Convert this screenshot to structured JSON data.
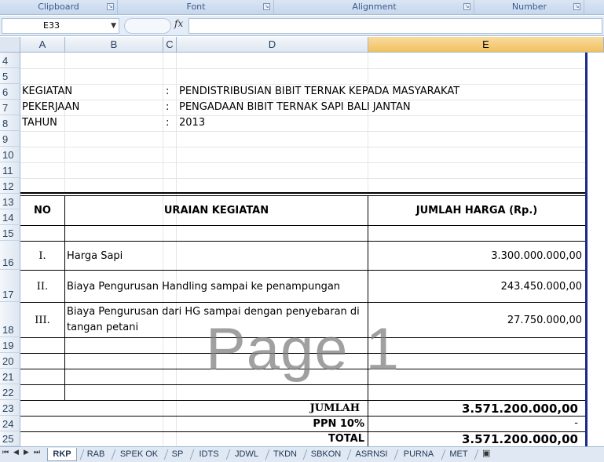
{
  "ribbon": {
    "groups": [
      "Clipboard",
      "Font",
      "Alignment",
      "Number"
    ]
  },
  "formula_bar": {
    "name_box": "E33",
    "fx_label": "fx",
    "formula": ""
  },
  "columns": [
    "A",
    "B",
    "C",
    "D",
    "E"
  ],
  "selected_column": "E",
  "rows": [
    "4",
    "5",
    "6",
    "7",
    "8",
    "9",
    "10",
    "11",
    "12",
    "13",
    "14",
    "15",
    "16",
    "17",
    "18",
    "19",
    "20",
    "21",
    "22",
    "23",
    "24",
    "25"
  ],
  "header": {
    "kegiatan_label": "KEGIATAN",
    "kegiatan_value": "PENDISTRIBUSIAN BIBIT TERNAK KEPADA MASYARAKAT",
    "pekerjaan_label": "PEKERJAAN",
    "pekerjaan_value": "PENGADAAN BIBIT TERNAK SAPI BALI JANTAN",
    "tahun_label": "TAHUN",
    "tahun_value": "2013",
    "colon": ":"
  },
  "table": {
    "col_no": "NO",
    "col_uraian": "URAIAN KEGIATAN",
    "col_jumlah": "JUMLAH HARGA  (Rp.)",
    "items": [
      {
        "no": "I.",
        "uraian": "Harga Sapi",
        "uraian2": "",
        "jumlah": "3.300.000.000,00"
      },
      {
        "no": "II.",
        "uraian": "Biaya Pengurusan Handling sampai ke penampungan",
        "uraian2": "",
        "jumlah": "243.450.000,00"
      },
      {
        "no": "III.",
        "uraian": "Biaya Pengurusan dari HG sampai dengan penyebaran di",
        "uraian2": "tangan petani",
        "jumlah": "27.750.000,00"
      }
    ],
    "jumlah_label": "JUMLAH",
    "jumlah_value": "3.571.200.000,00",
    "ppn_label": "PPN 10%",
    "ppn_value": "-",
    "total_label": "TOTAL",
    "total_value": "3.571.200.000,00"
  },
  "watermark": "Page 1",
  "sheet_tabs": [
    "RKP",
    "RAB",
    "SPEK OK",
    "SP",
    "IDTS",
    "JDWL",
    "TKDN",
    "SBKON",
    "ASRNSI",
    "PURNA",
    "MET"
  ],
  "active_tab": "RKP"
}
